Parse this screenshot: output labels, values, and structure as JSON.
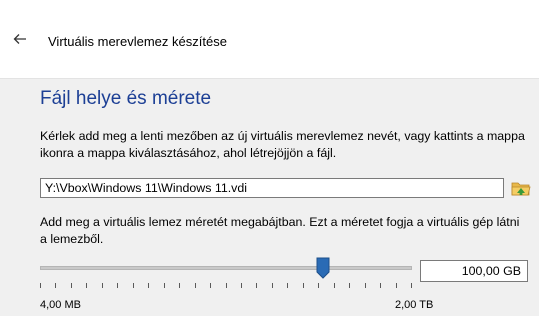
{
  "header": {
    "back_icon": "back-arrow-icon",
    "title": "Virtuális merevlemez készítése"
  },
  "page": {
    "heading": "Fájl helye és mérete",
    "instruction_location": "Kérlek add meg a lenti mezőben az új virtuális merevlemez nevét, vagy kattints a mappa ikonra a mappa kiválasztásához, ahol létrejöjjön a fájl.",
    "file_path_value": "Y:\\Vbox\\Windows 11\\Windows 11.vdi",
    "folder_icon": "choose-folder-icon",
    "instruction_size": "Add meg a virtuális lemez méretét megabájtban. Ezt a méretet fogja a virtuális gép látni a lemezből.",
    "size_slider": {
      "min_label": "4,00 MB",
      "max_label": "2,00 TB",
      "value_fraction": 0.76,
      "accent_color": "#2a6bb5"
    },
    "size_value": "100,00 GB"
  }
}
